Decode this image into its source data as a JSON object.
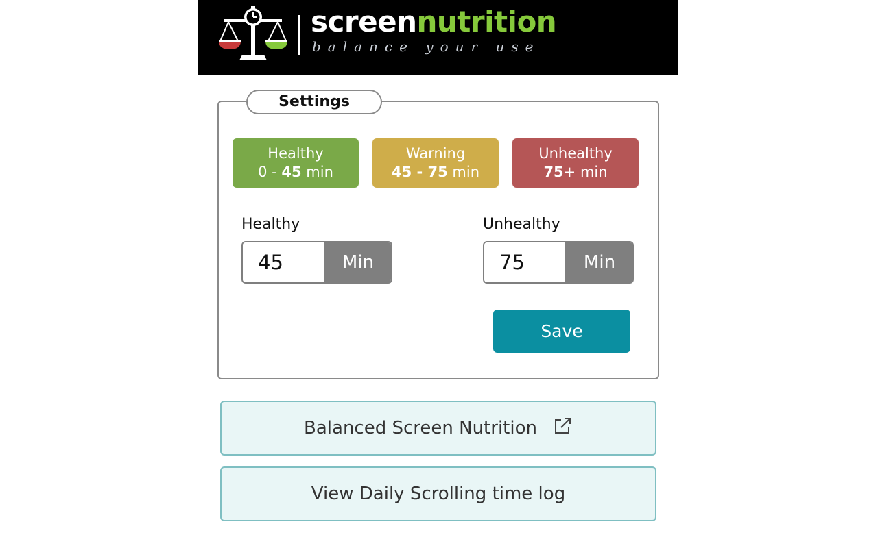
{
  "header": {
    "brand_part1": "screen",
    "brand_part2": "nutrition",
    "tagline": "balance your use",
    "colors": {
      "background": "#000000",
      "brand_white": "#ffffff",
      "brand_green": "#86c93b",
      "scale_red": "#c83a3a",
      "scale_green": "#86c93b"
    },
    "logo_icon": "balance-scale-clock-icon"
  },
  "settings": {
    "title": "Settings",
    "badges": [
      {
        "name": "Healthy",
        "range_prefix": "0 - ",
        "range_bold": "45",
        "range_suffix": " min",
        "color": "#7aa948"
      },
      {
        "name": "Warning",
        "range_prefix": "",
        "range_bold": "45 - 75",
        "range_suffix": " min",
        "color": "#cfad4a"
      },
      {
        "name": "Unhealthy",
        "range_prefix": "",
        "range_bold": "75",
        "range_suffix": "+ min",
        "color": "#b55656"
      }
    ],
    "healthy": {
      "label": "Healthy",
      "value": "45",
      "unit": "Min"
    },
    "unhealthy": {
      "label": "Unhealthy",
      "value": "75",
      "unit": "Min"
    },
    "save_label": "Save",
    "save_color": "#0b8fa1"
  },
  "links": {
    "balanced_label": "Balanced Screen Nutrition",
    "balanced_icon": "external-link-icon",
    "log_label": "View Daily Scrolling time log"
  }
}
